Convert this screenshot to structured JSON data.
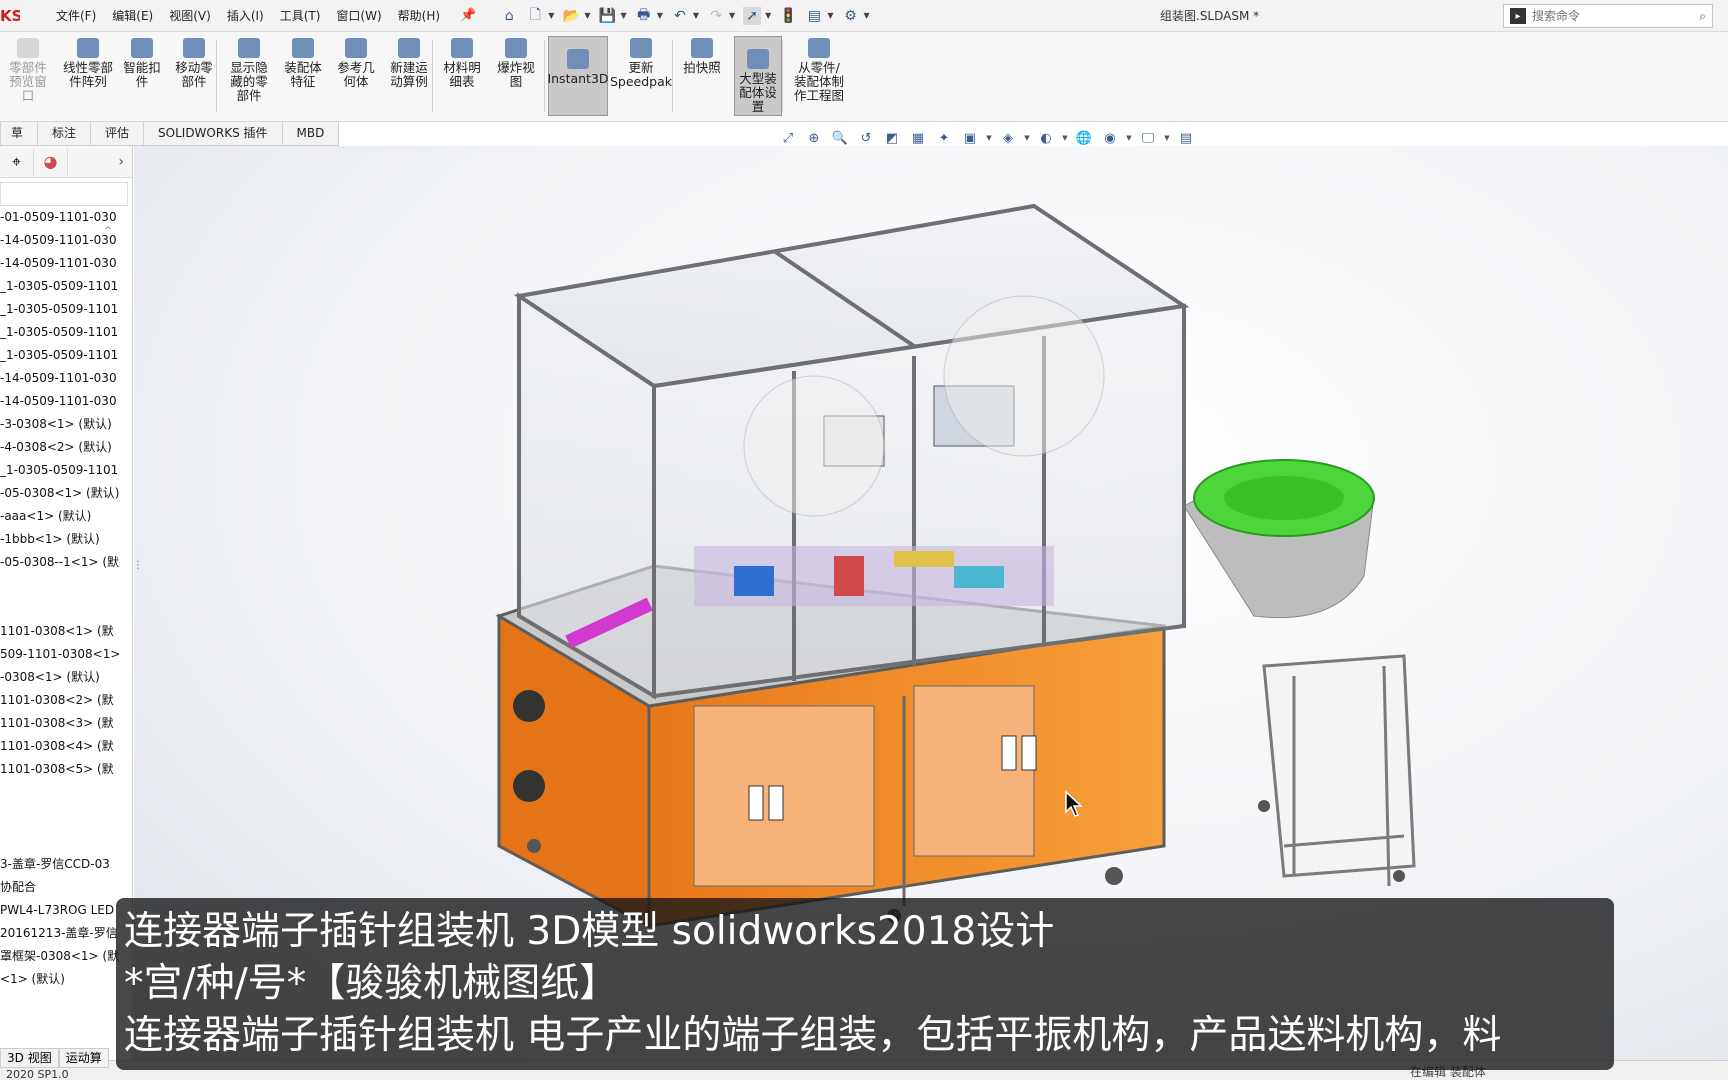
{
  "app": {
    "logo": "KS",
    "document_title": "组装图.SLDASM *"
  },
  "menu": {
    "items": [
      "文件(F)",
      "编辑(E)",
      "视图(V)",
      "插入(I)",
      "工具(T)",
      "窗口(W)",
      "帮助(H)"
    ]
  },
  "search": {
    "placeholder": "搜索命令"
  },
  "ribbon": {
    "buttons": [
      {
        "label": "零部件\n预览窗\n口",
        "disabled": true
      },
      {
        "label": "线性零部\n件阵列"
      },
      {
        "label": "智能扣\n件"
      },
      {
        "label": "移动零\n部件"
      },
      {
        "label": "显示隐\n藏的零\n部件"
      },
      {
        "label": "装配体\n特征"
      },
      {
        "label": "参考几\n何体"
      },
      {
        "label": "新建运\n动算例"
      },
      {
        "label": "材料明\n细表"
      },
      {
        "label": "爆炸视\n图"
      },
      {
        "label": "Instant3D",
        "active": true
      },
      {
        "label": "更新\nSpeedpak"
      },
      {
        "label": "拍快照"
      },
      {
        "label": "大型装\n配体设\n置",
        "active": true
      },
      {
        "label": "从零件/\n装配体制\n作工程图"
      }
    ]
  },
  "tabs": [
    "草图",
    "标注",
    "评估",
    "SOLIDWORKS 插件",
    "MBD"
  ],
  "tree": {
    "rows_top": [
      "-01-0509-1101-030",
      "-14-0509-1101-030",
      "-14-0509-1101-030",
      "_1-0305-0509-1101",
      "_1-0305-0509-1101",
      "_1-0305-0509-1101",
      "_1-0305-0509-1101",
      "-14-0509-1101-030",
      "-14-0509-1101-030",
      "-3-0308<1> (默认)",
      "-4-0308<2> (默认)",
      "_1-0305-0509-1101",
      "-05-0308<1> (默认)",
      "-aaa<1> (默认)",
      "-1bbb<1> (默认)",
      "-05-0308--1<1> (默"
    ],
    "rows_mid": [
      "1101-0308<1> (默",
      "509-1101-0308<1>",
      "-0308<1> (默认)",
      "1101-0308<2> (默",
      "1101-0308<3> (默",
      "1101-0308<4> (默",
      "1101-0308<5> (默"
    ],
    "rows_bottom": [
      "3-盖章-罗信CCD-03",
      "协配合",
      "PWL4-L73ROG LED",
      "20161213-盖章-罗信",
      "罩框架-0308<1> (默",
      "<1> (默认)"
    ],
    "bottom_tabs": [
      "3D 视图",
      "运动算"
    ],
    "version": "2020 SP1.0"
  },
  "status": {
    "text": "在编辑 装配体"
  },
  "subtitle": {
    "line1": "连接器端子插针组装机 3D模型  solidworks2018设计",
    "line2": "*宫/种/号*【骏骏机械图纸】",
    "line3": "连接器端子插针组装机 电子产业的端子组装，包括平振机构，产品送料机构，料"
  },
  "colors": {
    "base_orange": "#f08a1e",
    "bowl_green": "#4cd63a",
    "frame_gray": "#6d6f72",
    "logo_red": "#d01c1c"
  }
}
